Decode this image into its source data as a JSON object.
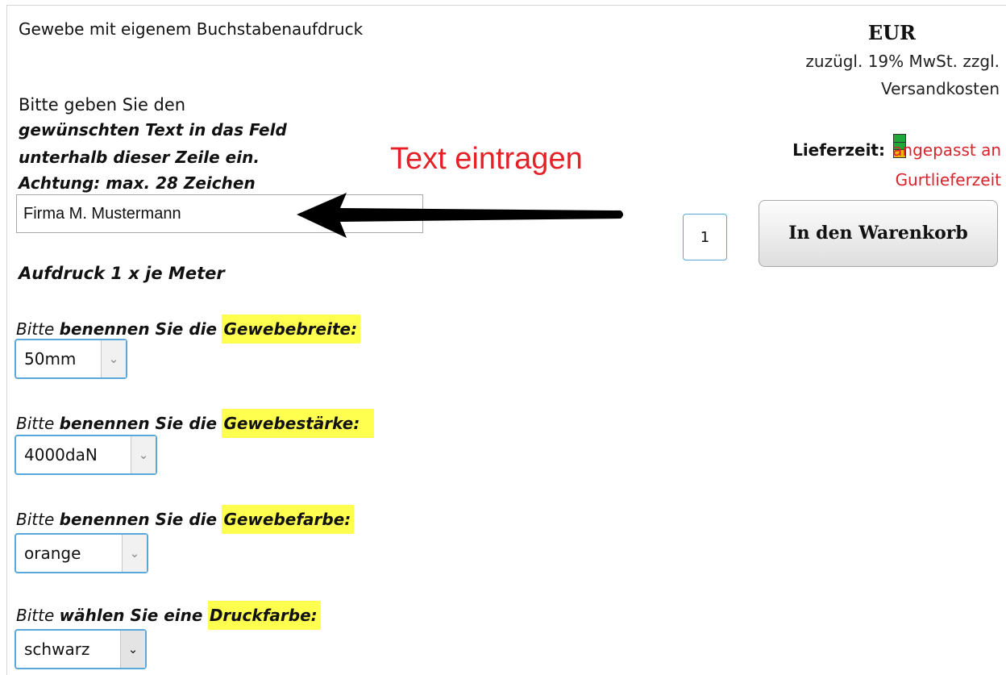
{
  "product": {
    "title": "Gewebe mit eigenem Buchstabenaufdruck"
  },
  "instructions": {
    "line_plain": "Bitte geben Sie den",
    "line_bold_1": "gewünschten Text in das Feld",
    "line_bold_2": "unterhalb dieser Zeile ein.",
    "line_bold_3": "Achtung: max. 28 Zeichen"
  },
  "text_field": {
    "value": "Firma M. Mustermann"
  },
  "annotation": {
    "label": "Text eintragen",
    "color": "#e42126",
    "icon": "arrow-left-icon"
  },
  "imprint_note": "Aufdruck 1 x je Meter",
  "options": [
    {
      "prefix": "Bitte",
      "bold": "benennen Sie die",
      "highlight": "Gewebebreite",
      "suffix": ":",
      "selected": "50mm"
    },
    {
      "prefix": "Bitte",
      "bold": "benennen Sie die",
      "highlight": "Gewebestärke",
      "suffix": ":",
      "selected": "4000daN"
    },
    {
      "prefix": "Bitte",
      "bold": "benennen Sie die",
      "highlight": "Gewebefarbe",
      "suffix": ":",
      "selected": "orange"
    },
    {
      "prefix": "Bitte",
      "bold": "wählen Sie eine",
      "highlight": "Druckfarbe",
      "suffix": ":",
      "selected": "schwarz"
    }
  ],
  "price": {
    "currency": "EUR",
    "tax_line_1": "zuzügl. 19% MwSt. zzgl.",
    "tax_line_2": "Versandkosten"
  },
  "delivery": {
    "label": "Lieferzeit:",
    "value_line_1": "angepasst an",
    "value_line_2": "Gurtlieferzeit",
    "value_color": "#d9232d",
    "indicator_colors": [
      "#1fa83a",
      "#1fa83a",
      "#f2b600"
    ]
  },
  "cart": {
    "quantity": "1",
    "button_label": "In den Warenkorb"
  },
  "colors": {
    "highlight": "#ffff4f",
    "select_border": "#5aa7d9"
  }
}
